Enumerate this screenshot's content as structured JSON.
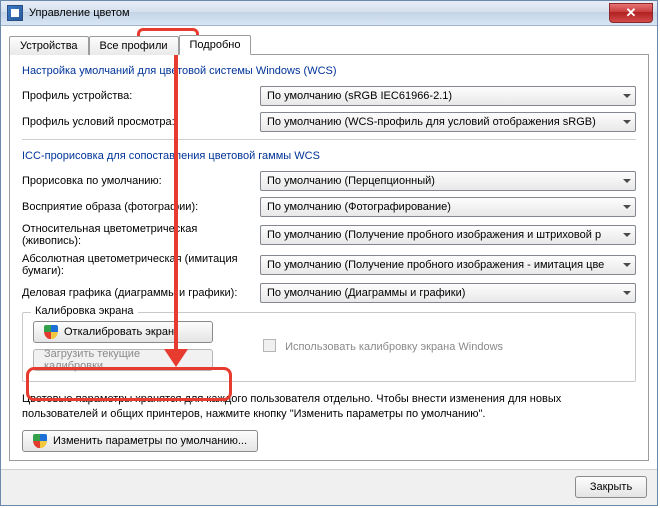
{
  "window": {
    "title": "Управление цветом",
    "close_label": "X"
  },
  "tabs": {
    "devices": "Устройства",
    "all_profiles": "Все профили",
    "advanced": "Подробно"
  },
  "sections": {
    "wcs_defaults": "Настройка умолчаний для цветовой системы Windows (WCS)",
    "icc_rendering": "ICC-прорисовка для сопоставления цветовой гаммы WCS",
    "calibration": "Калибровка экрана"
  },
  "labels": {
    "device_profile": "Профиль устройства:",
    "viewing_profile": "Профиль условий просмотра:",
    "default_rendering": "Прорисовка по умолчанию:",
    "perception": "Восприятие образа (фотографии):",
    "relative": "Относительная цветометрическая (живопись):",
    "absolute": "Абсолютная цветометрическая (имитация бумаги):",
    "business": "Деловая графика (диаграммы и графики):"
  },
  "values": {
    "device_profile": "По умолчанию (sRGB IEC61966-2.1)",
    "viewing_profile": "По умолчанию (WCS-профиль для условий отображения sRGB)",
    "default_rendering": "По умолчанию (Перцепционный)",
    "perception": "По умолчанию (Фотографирование)",
    "relative": "По умолчанию (Получение пробного изображения и штриховой р",
    "absolute": "По умолчанию (Получение пробного изображения - имитация цве",
    "business": "По умолчанию (Диаграммы и графики)"
  },
  "buttons": {
    "calibrate": "Откалибровать экран",
    "reload": "Загрузить текущие калибровки",
    "change_defaults": "Изменить параметры по умолчанию...",
    "close": "Закрыть"
  },
  "checkbox": {
    "use_windows_calibration": "Использовать калибровку экрана Windows"
  },
  "hint": "Цветовые параметры хранятся для каждого пользователя отдельно. Чтобы внести изменения для новых пользователей и общих принтеров, нажмите кнопку \"Изменить параметры по умолчанию\"."
}
